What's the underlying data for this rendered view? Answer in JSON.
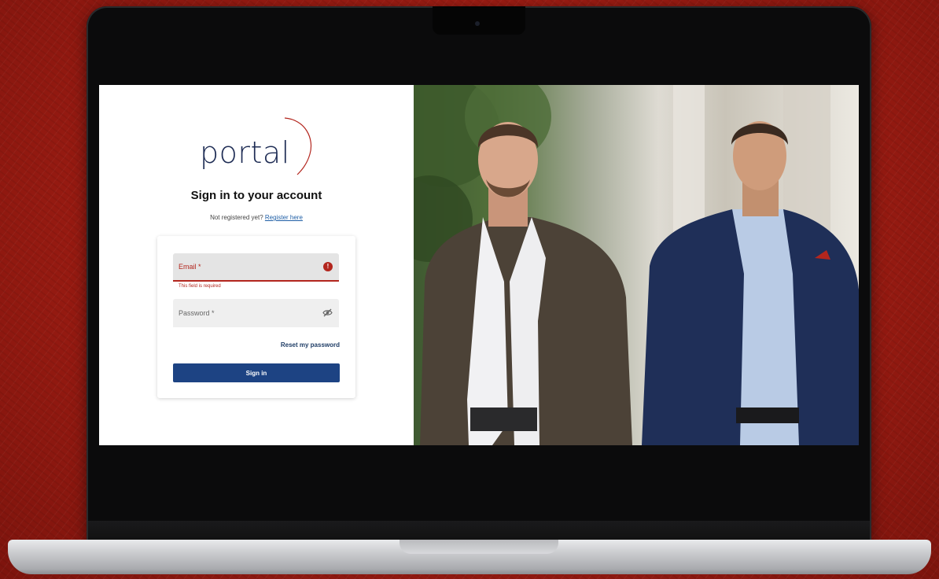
{
  "login": {
    "logo_text": "portal",
    "title": "Sign in to your account",
    "register_prompt": "Not registered yet?",
    "register_link": "Register here",
    "email_label": "Email *",
    "email_error_icon": "!",
    "email_error": "This field is required",
    "password_label": "Password *",
    "reset_link": "Reset my password",
    "signin_button": "Sign in"
  },
  "colors": {
    "background": "#9a1b12",
    "accent_red": "#b3261e",
    "button_blue": "#1d4383",
    "logo_navy": "#1f2d55"
  },
  "icons": {
    "email_error": "error-icon",
    "password_toggle": "eye-off-icon"
  }
}
